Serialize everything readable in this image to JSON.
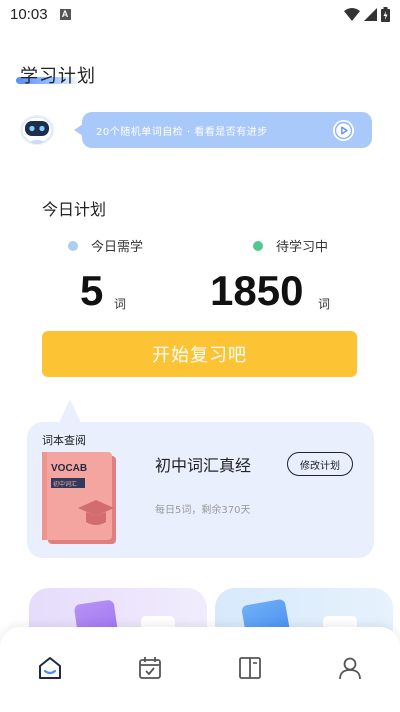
{
  "status_bar": {
    "time": "10:03",
    "notif_glyph": "A"
  },
  "page": {
    "title": "学习计划"
  },
  "assistant": {
    "icon": "robot-icon",
    "message": "20个随机单词自检 · 看看是否有进步"
  },
  "today_plan": {
    "heading": "今日计划",
    "need_label": "今日需学",
    "need_color": "#a9cff6",
    "need_count": "5",
    "need_unit": "词",
    "pending_label": "待学习中",
    "pending_color": "#52c98a",
    "pending_count": "1850",
    "pending_unit": "词",
    "start_button": "开始复习吧",
    "start_color": "#fcc435"
  },
  "book": {
    "tag": "词本查阅",
    "cover_title": "VOCAB",
    "cover_subtitle": "初中词汇",
    "name": "初中词汇真经",
    "modify_button": "修改计划",
    "progress": "每日5词，剩余370天"
  },
  "bottom_nav": [
    {
      "icon": "home-icon",
      "active": true
    },
    {
      "icon": "calendar-icon",
      "active": false
    },
    {
      "icon": "book-icon",
      "active": false
    },
    {
      "icon": "person-icon",
      "active": false
    }
  ]
}
